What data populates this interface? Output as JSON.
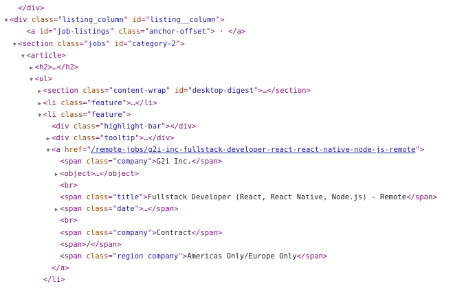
{
  "rows": [
    {
      "indent": 1,
      "tw": "none",
      "parts": [
        [
          "tag",
          "</div>"
        ]
      ]
    },
    {
      "indent": 0,
      "tw": "open",
      "parts": [
        [
          "tag",
          "<div "
        ],
        [
          "an",
          "class"
        ],
        [
          "eq",
          "=\""
        ],
        [
          "av",
          "listing_column"
        ],
        [
          "eq",
          "\" "
        ],
        [
          "an",
          "id"
        ],
        [
          "eq",
          "=\""
        ],
        [
          "av",
          "listing__column"
        ],
        [
          "eq",
          "\">"
        ]
      ]
    },
    {
      "indent": 2,
      "tw": "none",
      "parts": [
        [
          "tag",
          "<a "
        ],
        [
          "an",
          "id"
        ],
        [
          "eq",
          "=\""
        ],
        [
          "av",
          "job-listings"
        ],
        [
          "eq",
          "\" "
        ],
        [
          "an",
          "class"
        ],
        [
          "eq",
          "=\""
        ],
        [
          "av",
          "anchor-offset"
        ],
        [
          "eq",
          "\">"
        ],
        [
          "dot",
          " · "
        ],
        [
          "tag",
          "</a>"
        ]
      ]
    },
    {
      "indent": 1,
      "tw": "open",
      "parts": [
        [
          "tag",
          "<section "
        ],
        [
          "an",
          "class"
        ],
        [
          "eq",
          "=\""
        ],
        [
          "av",
          "jobs"
        ],
        [
          "eq",
          "\" "
        ],
        [
          "an",
          "id"
        ],
        [
          "eq",
          "=\""
        ],
        [
          "av",
          "category-2"
        ],
        [
          "eq",
          "\">"
        ]
      ]
    },
    {
      "indent": 2,
      "tw": "open",
      "parts": [
        [
          "tag",
          "<article>"
        ]
      ]
    },
    {
      "indent": 3,
      "tw": "closed",
      "parts": [
        [
          "tag",
          "<h2>"
        ],
        [
          "ell",
          "…"
        ],
        [
          "tag",
          "</h2>"
        ]
      ]
    },
    {
      "indent": 3,
      "tw": "open",
      "parts": [
        [
          "tag",
          "<ul>"
        ]
      ]
    },
    {
      "indent": 4,
      "tw": "closed",
      "parts": [
        [
          "tag",
          "<section "
        ],
        [
          "an",
          "class"
        ],
        [
          "eq",
          "=\""
        ],
        [
          "av",
          "content-wrap"
        ],
        [
          "eq",
          "\" "
        ],
        [
          "an",
          "id"
        ],
        [
          "eq",
          "=\""
        ],
        [
          "av",
          "desktop-digest"
        ],
        [
          "eq",
          "\">"
        ],
        [
          "ell",
          "…"
        ],
        [
          "tag",
          "</section>"
        ]
      ]
    },
    {
      "indent": 4,
      "tw": "closed",
      "parts": [
        [
          "tag",
          "<li "
        ],
        [
          "an",
          "class"
        ],
        [
          "eq",
          "=\""
        ],
        [
          "av",
          "feature"
        ],
        [
          "eq",
          "\">"
        ],
        [
          "ell",
          "…"
        ],
        [
          "tag",
          "</li>"
        ]
      ]
    },
    {
      "indent": 4,
      "tw": "open",
      "parts": [
        [
          "tag",
          "<li "
        ],
        [
          "an",
          "class"
        ],
        [
          "eq",
          "=\""
        ],
        [
          "av",
          "feature"
        ],
        [
          "eq",
          "\">"
        ]
      ]
    },
    {
      "indent": 5,
      "tw": "none",
      "parts": [
        [
          "tag",
          "<div "
        ],
        [
          "an",
          "class"
        ],
        [
          "eq",
          "=\""
        ],
        [
          "av",
          "highlight-bar"
        ],
        [
          "eq",
          "\">"
        ],
        [
          "tag",
          "</div>"
        ]
      ]
    },
    {
      "indent": 5,
      "tw": "closed",
      "parts": [
        [
          "tag",
          "<div "
        ],
        [
          "an",
          "class"
        ],
        [
          "eq",
          "=\""
        ],
        [
          "av",
          "tooltip"
        ],
        [
          "eq",
          "\">"
        ],
        [
          "ell",
          "…"
        ],
        [
          "tag",
          "</div>"
        ]
      ]
    },
    {
      "indent": 5,
      "tw": "open",
      "parts": [
        [
          "tag",
          "<a "
        ],
        [
          "an",
          "href"
        ],
        [
          "eq",
          "=\""
        ],
        [
          "lnk",
          "/remote-jobs/g2i-inc-fullstack-developer-react-react-native-node-js-remote"
        ],
        [
          "eq",
          "\">"
        ]
      ]
    },
    {
      "indent": 6,
      "tw": "none",
      "parts": [
        [
          "tag",
          "<span "
        ],
        [
          "an",
          "class"
        ],
        [
          "eq",
          "=\""
        ],
        [
          "av",
          "company"
        ],
        [
          "eq",
          "\">"
        ],
        [
          "tx",
          "G2i Inc."
        ],
        [
          "tag",
          "</span>"
        ]
      ]
    },
    {
      "indent": 6,
      "tw": "closed",
      "parts": [
        [
          "tag",
          "<object>"
        ],
        [
          "ell",
          "…"
        ],
        [
          "tag",
          "</object>"
        ]
      ]
    },
    {
      "indent": 6,
      "tw": "none",
      "parts": [
        [
          "tag",
          "<br>"
        ]
      ]
    },
    {
      "indent": 6,
      "tw": "none",
      "parts": [
        [
          "tag",
          "<span "
        ],
        [
          "an",
          "class"
        ],
        [
          "eq",
          "=\""
        ],
        [
          "av",
          "title"
        ],
        [
          "eq",
          "\">"
        ],
        [
          "tx",
          "Fullstack Developer (React, React Native, Node.js) - Remote"
        ],
        [
          "tag",
          "</span>"
        ]
      ]
    },
    {
      "indent": 6,
      "tw": "closed",
      "parts": [
        [
          "tag",
          "<span "
        ],
        [
          "an",
          "class"
        ],
        [
          "eq",
          "=\""
        ],
        [
          "av",
          "date"
        ],
        [
          "eq",
          "\">"
        ],
        [
          "ell",
          "…"
        ],
        [
          "tag",
          "</span>"
        ]
      ]
    },
    {
      "indent": 6,
      "tw": "none",
      "parts": [
        [
          "tag",
          "<br>"
        ]
      ]
    },
    {
      "indent": 6,
      "tw": "none",
      "parts": [
        [
          "tag",
          "<span "
        ],
        [
          "an",
          "class"
        ],
        [
          "eq",
          "=\""
        ],
        [
          "av",
          "company"
        ],
        [
          "eq",
          "\">"
        ],
        [
          "tx",
          "Contract"
        ],
        [
          "tag",
          "</span>"
        ]
      ]
    },
    {
      "indent": 6,
      "tw": "none",
      "parts": [
        [
          "tag",
          "<span>"
        ],
        [
          "tx",
          "/"
        ],
        [
          "tag",
          "</span>"
        ]
      ]
    },
    {
      "indent": 6,
      "tw": "none",
      "parts": [
        [
          "tag",
          "<span "
        ],
        [
          "an",
          "class"
        ],
        [
          "eq",
          "=\""
        ],
        [
          "av",
          "region company"
        ],
        [
          "eq",
          "\">"
        ],
        [
          "tx",
          "Americas Only/Europe Only"
        ],
        [
          "tag",
          "</span>"
        ]
      ]
    },
    {
      "indent": 5,
      "tw": "none",
      "parts": [
        [
          "tag",
          "</a>"
        ]
      ]
    },
    {
      "indent": 4,
      "tw": "none",
      "parts": [
        [
          "tag",
          "</li>"
        ]
      ]
    }
  ],
  "colors": {
    "tag": "#881280",
    "attr_name": "#994500",
    "attr_value": "#1a1aa6",
    "text": "#222222",
    "twisty": "#6e6e6e"
  },
  "icons": {
    "open": "triangle-down-icon",
    "closed": "triangle-right-icon"
  }
}
